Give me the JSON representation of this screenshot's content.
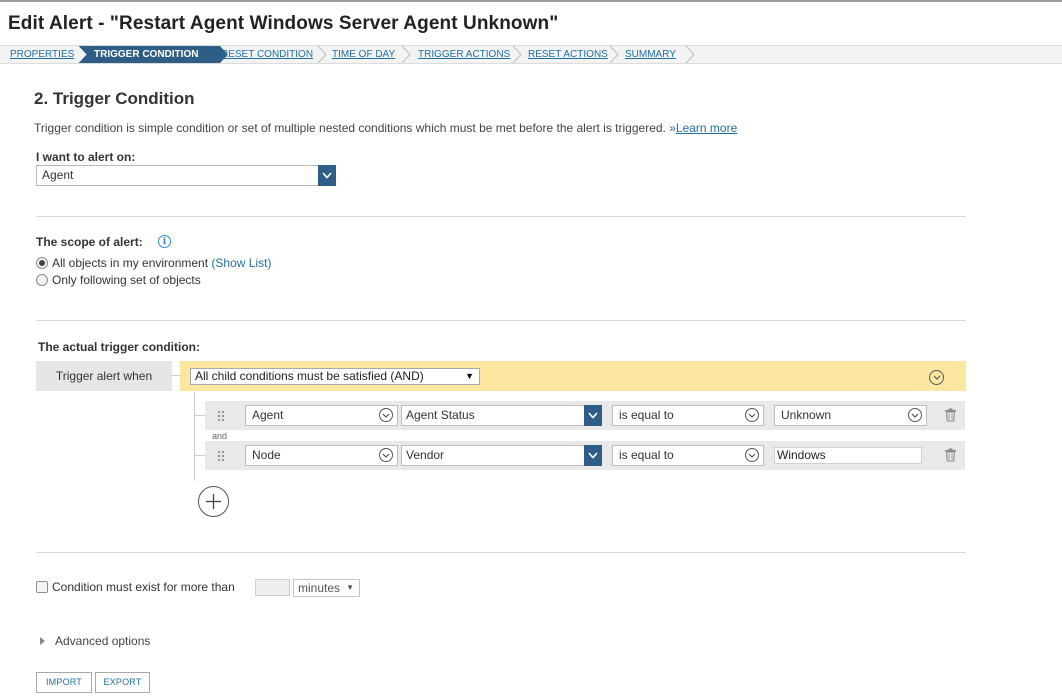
{
  "page": {
    "title": "Edit Alert - \"Restart Agent Windows Server Agent Unknown\""
  },
  "breadcrumbs": [
    {
      "label": "PROPERTIES",
      "active": false
    },
    {
      "label": "TRIGGER CONDITION",
      "active": true
    },
    {
      "label": "RESET CONDITION",
      "active": false
    },
    {
      "label": "TIME OF DAY",
      "active": false
    },
    {
      "label": "TRIGGER ACTIONS",
      "active": false
    },
    {
      "label": "RESET ACTIONS",
      "active": false
    },
    {
      "label": "SUMMARY",
      "active": false
    }
  ],
  "section": {
    "title": "2. Trigger Condition",
    "description": "Trigger condition is simple condition or set of multiple nested conditions which must be met before the alert is triggered.",
    "learn_more_prefix": "»",
    "learn_more": "Learn more"
  },
  "alert_on": {
    "label": "I want to alert on:",
    "value": "Agent"
  },
  "scope": {
    "label": "The scope of alert:",
    "info_icon": "info-icon",
    "options": [
      {
        "label": "All objects in my environment",
        "link": "(Show List)",
        "selected": true
      },
      {
        "label": "Only following set of objects",
        "selected": false
      }
    ]
  },
  "trigger": {
    "label": "The actual trigger condition:",
    "when_label": "Trigger alert when",
    "group_operator": "All child conditions must be satisfied (AND)",
    "and_label": "and",
    "conditions": [
      {
        "object": "Agent",
        "field": "Agent Status",
        "operator": "is equal to",
        "value": "Unknown",
        "value_type": "select"
      },
      {
        "object": "Node",
        "field": "Vendor",
        "operator": "is equal to",
        "value": "Windows",
        "value_type": "text"
      }
    ]
  },
  "duration": {
    "label": "Condition must exist for more than",
    "value": "",
    "unit": "minutes",
    "checked": false
  },
  "advanced": {
    "label": "Advanced options"
  },
  "buttons": {
    "import": "IMPORT",
    "export": "EXPORT"
  },
  "colors": {
    "accent": "#2e5e86",
    "link": "#1f6fa3",
    "condition_group_bg": "#fce7a1"
  }
}
